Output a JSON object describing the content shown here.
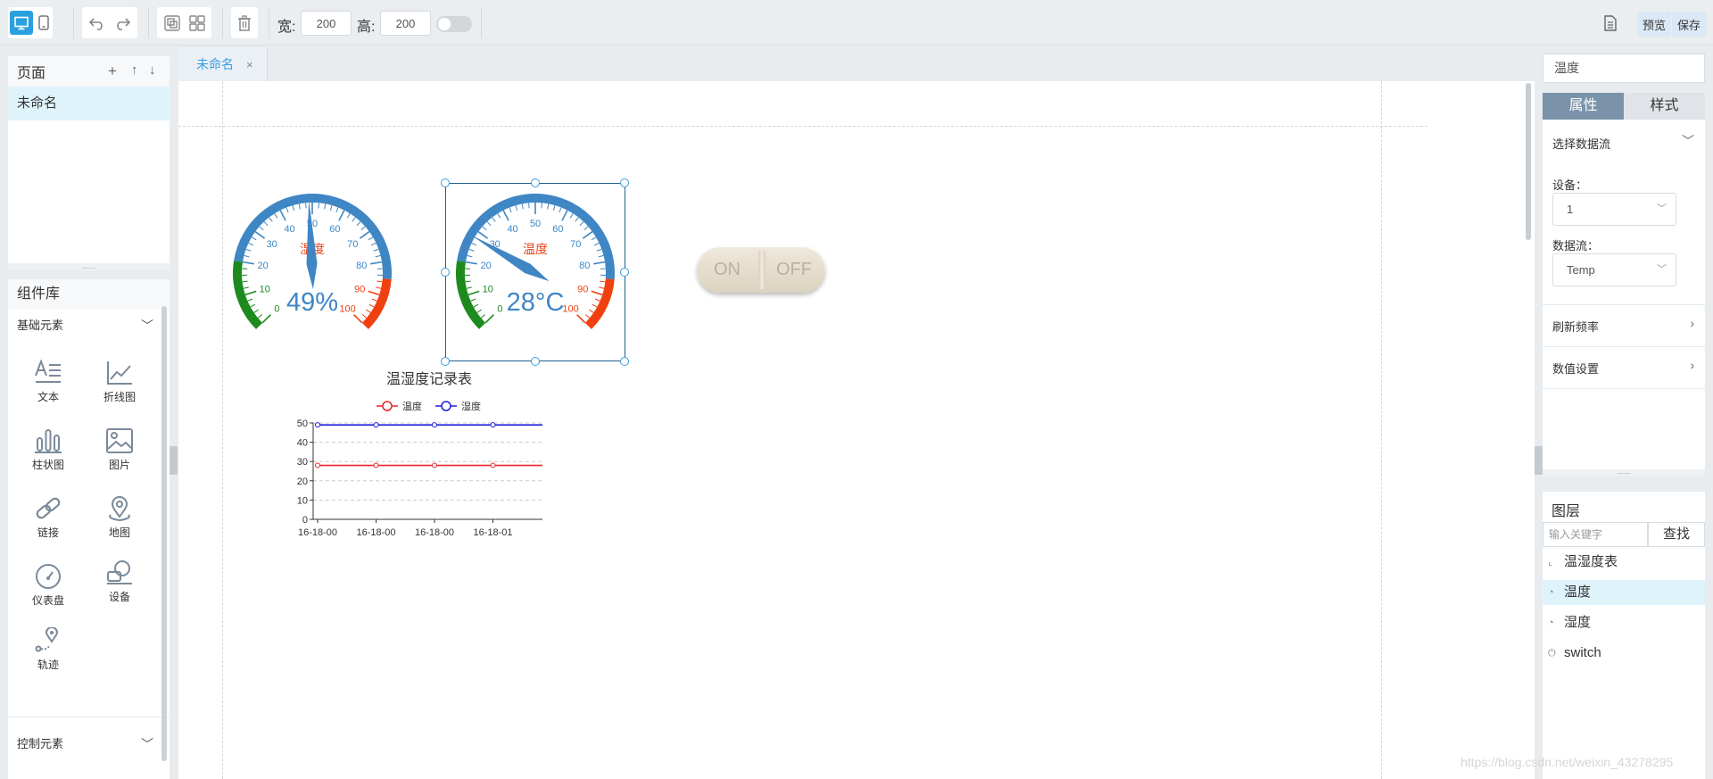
{
  "toolbar": {
    "width_label": "宽:",
    "width_value": "200",
    "height_label": "高:",
    "height_value": "200",
    "preview_label": "预览",
    "save_label": "保存"
  },
  "pages": {
    "title": "页面",
    "items": [
      {
        "label": "未命名"
      }
    ]
  },
  "components": {
    "title": "组件库",
    "section_basic": "基础元素",
    "section_control": "控制元素",
    "items": [
      {
        "label": "文本",
        "icon": "text-icon"
      },
      {
        "label": "折线图",
        "icon": "line-chart-icon"
      },
      {
        "label": "柱状图",
        "icon": "bar-chart-icon"
      },
      {
        "label": "图片",
        "icon": "image-icon"
      },
      {
        "label": "链接",
        "icon": "link-icon"
      },
      {
        "label": "地图",
        "icon": "map-pin-icon"
      },
      {
        "label": "仪表盘",
        "icon": "gauge-icon"
      },
      {
        "label": "设备",
        "icon": "device-icon"
      },
      {
        "label": "轨迹",
        "icon": "track-icon"
      }
    ]
  },
  "editor": {
    "tab_label": "未命名",
    "tab_close": "×"
  },
  "gauges": [
    {
      "value_text": "49%",
      "label": "湿度",
      "ticks": [
        "0",
        "10",
        "20",
        "30",
        "40",
        "50",
        "60",
        "70",
        "80",
        "90",
        "100"
      ],
      "value": 49
    },
    {
      "value_text": "28°C",
      "label": "温度",
      "ticks": [
        "0",
        "10",
        "20",
        "30",
        "40",
        "50",
        "60",
        "70",
        "80",
        "90",
        "100"
      ],
      "value": 28
    }
  ],
  "switch": {
    "on": "ON",
    "off": "OFF"
  },
  "chart_data": {
    "type": "line",
    "title": "温湿度记录表",
    "categories": [
      "16-18-00",
      "16-18-00",
      "16-18-00",
      "16-18-01"
    ],
    "series": [
      {
        "name": "温度",
        "values": [
          28,
          28,
          28,
          28
        ],
        "color": "#e8262a"
      },
      {
        "name": "湿度",
        "values": [
          49,
          49,
          49,
          49
        ],
        "color": "#2020d8"
      }
    ],
    "yticks": [
      "0",
      "10",
      "20",
      "30",
      "40",
      "50"
    ],
    "ylim": [
      0,
      50
    ],
    "grid": true,
    "legend": "top"
  },
  "properties": {
    "name_value": "温度",
    "tab_attr": "属性",
    "tab_style": "样式",
    "section_datastream": "选择数据流",
    "device_label": "设备：",
    "device_value": "1",
    "stream_label": "数据流：",
    "stream_value": "Temp",
    "refresh_label": "刷新频率",
    "value_settings_label": "数值设置"
  },
  "layers": {
    "title": "图层",
    "search_placeholder": "输入关键字",
    "search_button": "查找",
    "items": [
      {
        "label": "温湿度表",
        "icon": "line-chart-icon"
      },
      {
        "label": "温度",
        "icon": "gauge-icon"
      },
      {
        "label": "湿度",
        "icon": "gauge-icon"
      },
      {
        "label": "switch",
        "icon": "power-icon"
      }
    ]
  },
  "watermark": "https://blog.csdn.net/weixin_43278295",
  "colors": {
    "accent": "#3a9cde",
    "gauge_blue": "#3f86c4",
    "gauge_green": "#1e8a1e",
    "gauge_red": "#f04010"
  }
}
